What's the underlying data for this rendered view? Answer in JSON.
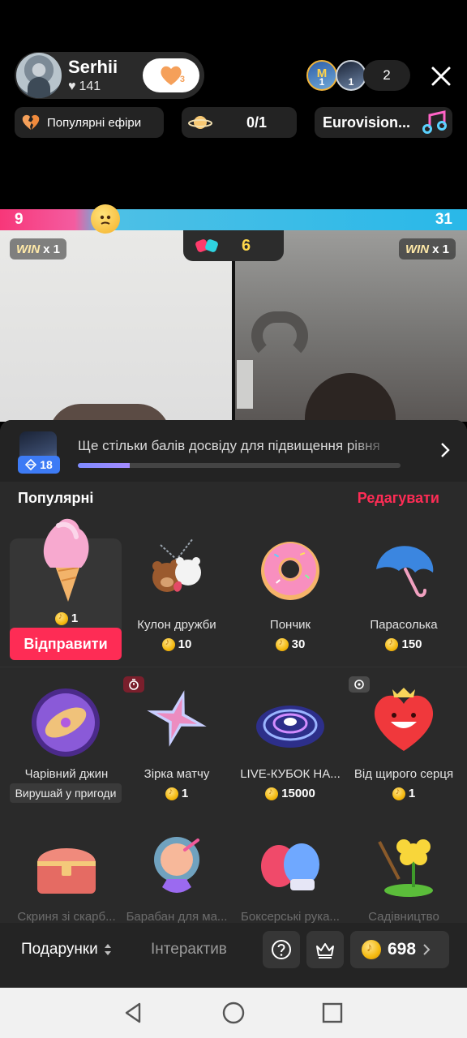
{
  "header": {
    "host_name": "Serhii",
    "host_likes": "141",
    "follow_badge": "3",
    "viewer_avatars": [
      {
        "initial": "M",
        "level": "1"
      },
      {
        "initial": "",
        "level": "1"
      }
    ],
    "viewer_count": "2",
    "chips": {
      "popular": "Популярні ефіри",
      "goal_value": "0/1",
      "music": "Eurovision..."
    }
  },
  "battle": {
    "left_score": "9",
    "right_score": "31",
    "timer": "6",
    "win_left": {
      "label": "WIN",
      "mult": "x 1"
    },
    "win_right": {
      "label": "WIN",
      "mult": "x 1"
    }
  },
  "sheet": {
    "level": {
      "badge": "18",
      "text": "Ще стільки балів досвіду для підвищення рівня",
      "progress": 0.16
    },
    "section_title": "Популярні",
    "edit_label": "Редагувати",
    "selected": {
      "price": "1",
      "send_label": "Відправити"
    },
    "gifts_row1": [
      {
        "name": "Кулон дружби",
        "price": "10"
      },
      {
        "name": "Пончик",
        "price": "30"
      },
      {
        "name": "Парасолька",
        "price": "150"
      }
    ],
    "gifts_row2": [
      {
        "name": "Чарівний джин",
        "desc": "Вирушай у пригоди"
      },
      {
        "name": "Зірка матчу",
        "price": "1"
      },
      {
        "name": "LIVE-КУБОК НА...",
        "price": "15000"
      },
      {
        "name": "Від щирого серця",
        "price": "1"
      }
    ],
    "gifts_row3": [
      {
        "name": "Скриня зі скарб..."
      },
      {
        "name": "Барабан для ма..."
      },
      {
        "name": "Боксерські рука..."
      },
      {
        "name": "Садівництво"
      }
    ]
  },
  "bottom": {
    "tab_gifts": "Подарунки",
    "tab_interactive": "Інтерактив",
    "coins": "698"
  },
  "colors": {
    "accent": "#fe2c55",
    "battle_left": "#f73779",
    "battle_right": "#29b8e8",
    "coin": "#f4b90f"
  }
}
